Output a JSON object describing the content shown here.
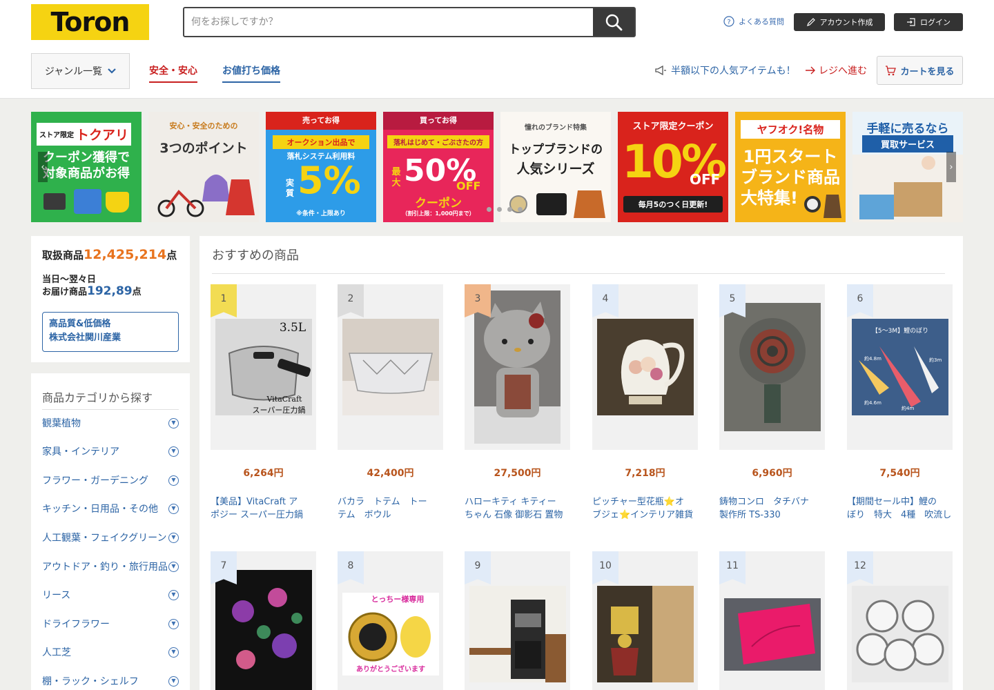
{
  "header": {
    "logo": "Toron",
    "search_placeholder": "何をお探しですか？",
    "help": "よくある質問",
    "signup": "アカウント作成",
    "login": "ログイン"
  },
  "nav": {
    "genre": "ジャンル一覧",
    "safety": "安全・安心",
    "bargain": "お値打ち価格",
    "promo": "半額以下の人気アイテムも！",
    "checkout": "レジへ進む",
    "cart": "カートを見る"
  },
  "banners": [
    {
      "line1": "ストア限定",
      "line2": "トクアリ",
      "line3": "クーポン獲得で",
      "line4": "対象商品がお得"
    },
    {
      "line1": "安心・安全のための",
      "line2": "3つのポイント"
    },
    {
      "line1": "売ってお得",
      "line2": "オークション出品で",
      "line3": "落札システム利用料",
      "line4": "5%",
      "line5": "実質",
      "line6": "※条件・上限あり"
    },
    {
      "line1": "買ってお得",
      "line2": "落札はじめて・ごぶさたの方",
      "line3": "最大",
      "line4": "50%",
      "line5": "OFF",
      "line6": "クーポン",
      "line7": "（割引上限：1,000円まで）"
    },
    {
      "line1": "憧れのブランド特集",
      "line2": "トップブランドの",
      "line3": "人気シリーズ"
    },
    {
      "line1": "ストア限定クーポン",
      "line2": "10%",
      "line3": "OFF",
      "line4": "毎月5のつく日更新!"
    },
    {
      "line1": "ヤフオク!名物",
      "line2": "1円スタート",
      "line3": "ブランド商品",
      "line4": "大特集!"
    },
    {
      "line1": "手軽に売るなら",
      "line2": "買取サービス"
    }
  ],
  "stats": {
    "total_label": "取扱商品",
    "total_value": "12,425,214",
    "total_unit": "点",
    "delivery_line1": "当日〜翌々日",
    "delivery_label": "お届け商品",
    "delivery_value": "192,89",
    "delivery_unit": "点",
    "company_line1": "高品質&低価格",
    "company_line2": "株式会社関川産業"
  },
  "categories": {
    "title": "商品カテゴリから探す",
    "items": [
      "観葉植物",
      "家具・インテリア",
      "フラワー・ガーデニング",
      "キッチン・日用品・その他",
      "人工観葉・フェイクグリーン",
      "アウトドア・釣り・旅行用品",
      "リース",
      "ドライフラワー",
      "人工芝",
      "棚・ラック・シェルフ"
    ]
  },
  "recommended": {
    "title": "おすすめの商品",
    "products": [
      {
        "rank": "1",
        "price": "6,264円",
        "name1": "【美品】VitaCraft ア",
        "name2": "ポジー スーパー圧力鍋",
        "rank_color": "#f2dc53"
      },
      {
        "rank": "2",
        "price": "42,400円",
        "name1": "バカラ　トテム　トー",
        "name2": "テム　ボウル",
        "rank_color": "#dcdcdc"
      },
      {
        "rank": "3",
        "price": "27,500円",
        "name1": "ハローキティ キティー",
        "name2": "ちゃん 石像 御影石 置物",
        "rank_color": "#f0b68a"
      },
      {
        "rank": "4",
        "price": "7,218円",
        "name1": "ピッチャー型花瓶⭐オ",
        "name2": "ブジェ⭐インテリア雑貨",
        "rank_color": "#e1ebf8"
      },
      {
        "rank": "5",
        "price": "6,960円",
        "name1": "鋳物コンロ　タチバナ",
        "name2": "製作所 TS-330",
        "rank_color": "#e1ebf8"
      },
      {
        "rank": "6",
        "price": "7,540円",
        "name1": "【期間セール中】鯉の",
        "name2": "ぼり　特大　4種　吹流し",
        "rank_color": "#e1ebf8"
      },
      {
        "rank": "7",
        "rank_color": "#e1ebf8"
      },
      {
        "rank": "8",
        "rank_color": "#e1ebf8"
      },
      {
        "rank": "9",
        "rank_color": "#e1ebf8"
      },
      {
        "rank": "10",
        "rank_color": "#e1ebf8"
      },
      {
        "rank": "11",
        "rank_color": "#e1ebf8"
      },
      {
        "rank": "12",
        "rank_color": "#e1ebf8"
      }
    ],
    "image_texts": {
      "p1_size": "3.5L",
      "p1_brand": "VitaCraft",
      "p1_type": "スーパー圧力鍋",
      "p6_label": "【5〜3M】鯉のぼり",
      "p6_s1": "約4.8m",
      "p6_s2": "約3m",
      "p6_s3": "約4.6m",
      "p6_s4": "約4m",
      "p8_top": "とっちー様専用",
      "p8_bottom": "ありがとうございます"
    }
  },
  "colors": {
    "brand_yellow": "#f5d312",
    "link_blue": "#2c64a5",
    "accent_red": "#c81f1f",
    "price_orange": "#b8541c",
    "stat_orange": "#e8731e"
  }
}
